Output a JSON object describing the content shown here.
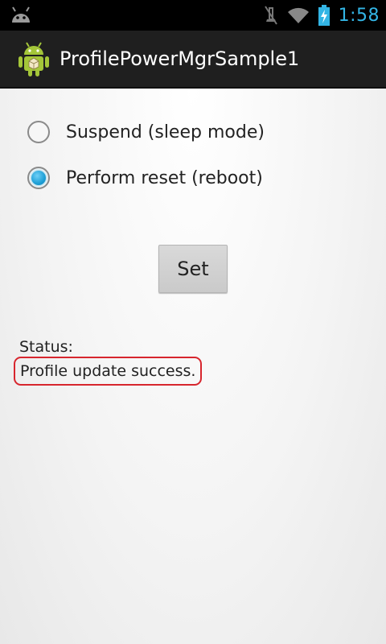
{
  "status_bar": {
    "time": "1:58",
    "icons": [
      "android-robot-icon",
      "mute-icon",
      "wifi-icon",
      "battery-charging-icon"
    ],
    "accent_color": "#33b5e5"
  },
  "action_bar": {
    "title": "ProfilePowerMgrSample1",
    "icon": "android-app-icon"
  },
  "options": [
    {
      "label": "Suspend (sleep mode)",
      "checked": false
    },
    {
      "label": "Perform reset (reboot)",
      "checked": true
    }
  ],
  "set_button": {
    "label": "Set"
  },
  "status": {
    "label": "Status:",
    "value": "Profile update success.",
    "highlight_color": "#d7262e"
  }
}
